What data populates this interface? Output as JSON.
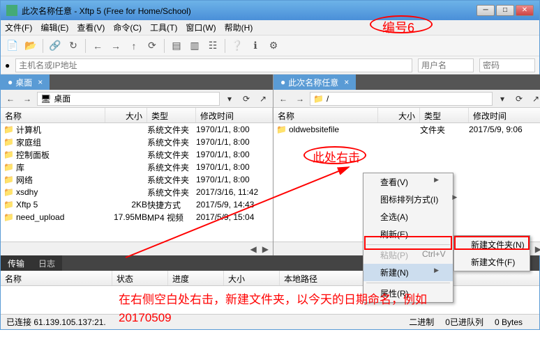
{
  "title": "此次名称任意    - Xftp 5 (Free for Home/School)",
  "menu": [
    "文件(F)",
    "编辑(E)",
    "查看(V)",
    "命令(C)",
    "工具(T)",
    "窗口(W)",
    "帮助(H)"
  ],
  "addr": {
    "host_placeholder": "主机名或IP地址",
    "user_placeholder": "用户名",
    "pw_placeholder": "密码"
  },
  "left": {
    "tab": "桌面",
    "path": "桌面",
    "cols": [
      "名称",
      "大小",
      "类型",
      "修改时间"
    ],
    "rows": [
      {
        "name": "计算机",
        "size": "",
        "type": "系统文件夹",
        "date": "1970/1/1, 8:00"
      },
      {
        "name": "家庭组",
        "size": "",
        "type": "系统文件夹",
        "date": "1970/1/1, 8:00"
      },
      {
        "name": "控制面板",
        "size": "",
        "type": "系统文件夹",
        "date": "1970/1/1, 8:00"
      },
      {
        "name": "库",
        "size": "",
        "type": "系统文件夹",
        "date": "1970/1/1, 8:00"
      },
      {
        "name": "网络",
        "size": "",
        "type": "系统文件夹",
        "date": "1970/1/1, 8:00"
      },
      {
        "name": "xsdhy",
        "size": "",
        "type": "系统文件夹",
        "date": "2017/3/16, 11:42"
      },
      {
        "name": "Xftp 5",
        "size": "2KB",
        "type": "快捷方式",
        "date": "2017/5/9, 14:43"
      },
      {
        "name": "need_upload",
        "size": "17.95MB",
        "type": "MP4 视频",
        "date": "2017/5/9, 15:04"
      }
    ]
  },
  "right": {
    "tab": "此次名称任意",
    "path": "/",
    "cols": [
      "名称",
      "大小",
      "类型",
      "修改时间"
    ],
    "rows": [
      {
        "name": "oldwebsitefile",
        "size": "",
        "type": "文件夹",
        "date": "2017/5/9, 9:06"
      }
    ]
  },
  "bottom": {
    "tabs": [
      "传输",
      "日志"
    ],
    "cols": [
      "名称",
      "状态",
      "进度",
      "大小",
      "本地路径"
    ]
  },
  "status": {
    "conn": "已连接 61.139.105.137:21.",
    "binary": "二进制",
    "queue": "0已进队列",
    "bytes": "0 Bytes"
  },
  "ctx": {
    "main": [
      {
        "label": "查看(V)",
        "arrow": true
      },
      {
        "label": "图标排列方式(I)",
        "arrow": true
      },
      {
        "label": "全选(A)"
      },
      {
        "label": "刷新(E)"
      },
      {
        "sep": true
      },
      {
        "label": "粘贴(P)",
        "disabled": true,
        "shortcut": "Ctrl+V"
      },
      {
        "label": "新建(N)",
        "arrow": true,
        "hover": true
      },
      {
        "sep": true
      },
      {
        "label": "属性(R)"
      }
    ],
    "sub": [
      {
        "label": "新建文件夹(N)"
      },
      {
        "label": "新建文件(F)"
      }
    ]
  },
  "annot": {
    "badge": "编号6",
    "rc": "此处右击",
    "instr": "在右侧空白处右击，新建文件夹，以今天的日期命名，例如20170509"
  }
}
